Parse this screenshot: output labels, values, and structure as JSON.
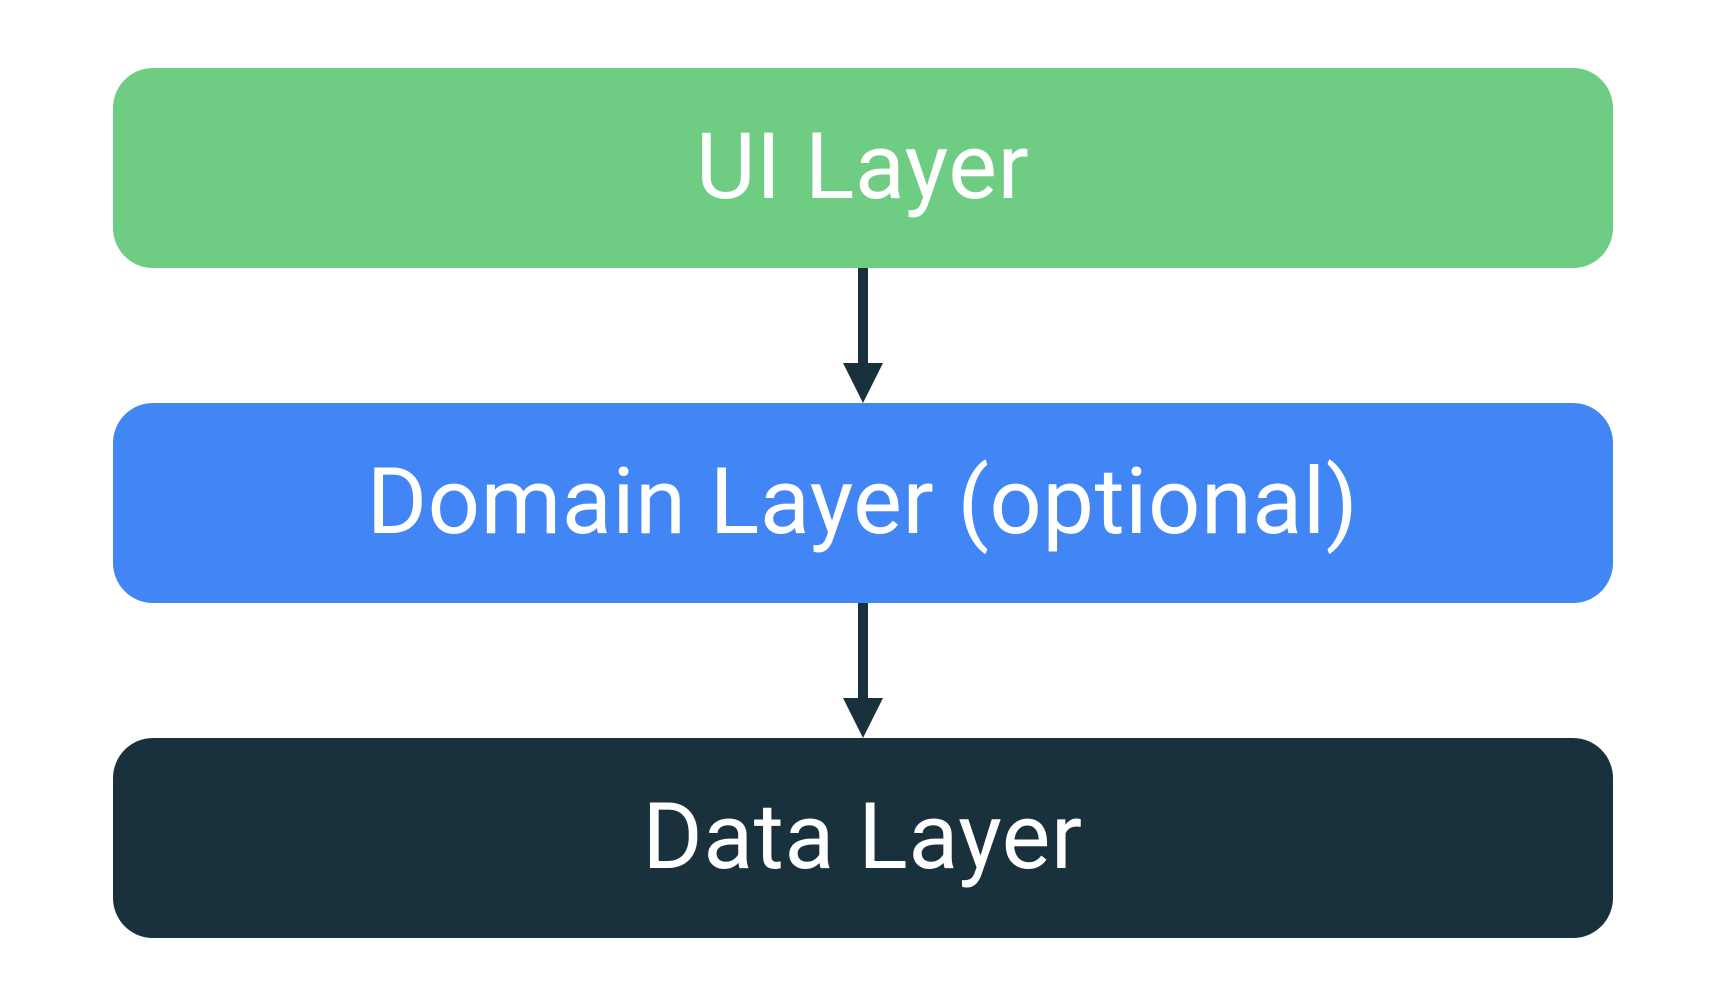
{
  "layers": {
    "ui": {
      "label": "UI Layer",
      "color": "#6ecc83"
    },
    "domain": {
      "label": "Domain Layer (optional)",
      "color": "#4285f4"
    },
    "data": {
      "label": "Data Layer",
      "color": "#19303d"
    }
  },
  "arrow_color": "#19303d"
}
